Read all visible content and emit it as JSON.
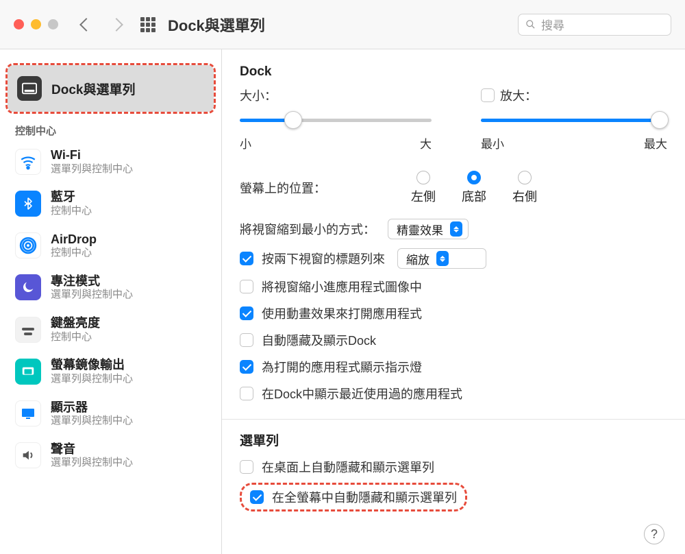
{
  "toolbar": {
    "title": "Dock與選單列",
    "search_placeholder": "搜尋"
  },
  "sidebar": {
    "selected": {
      "label": "Dock與選單列"
    },
    "section_label": "控制中心",
    "items": [
      {
        "title": "Wi-Fi",
        "sub": "選單列與控制中心"
      },
      {
        "title": "藍牙",
        "sub": "控制中心"
      },
      {
        "title": "AirDrop",
        "sub": "控制中心"
      },
      {
        "title": "專注模式",
        "sub": "選單列與控制中心"
      },
      {
        "title": "鍵盤亮度",
        "sub": "控制中心"
      },
      {
        "title": "螢幕鏡像輸出",
        "sub": "選單列與控制中心"
      },
      {
        "title": "顯示器",
        "sub": "選單列與控制中心"
      },
      {
        "title": "聲音",
        "sub": "選單列與控制中心"
      }
    ]
  },
  "main": {
    "dock_header": "Dock",
    "size_label": "大小：",
    "size_min": "小",
    "size_max": "大",
    "mag_label": "放大：",
    "mag_min": "最小",
    "mag_max": "最大",
    "position_label": "螢幕上的位置：",
    "pos_left": "左側",
    "pos_bottom": "底部",
    "pos_right": "右側",
    "minimize_label": "將視窗縮到最小的方式：",
    "minimize_value": "精靈效果",
    "dbl_label": "按兩下視窗的標題列來",
    "dbl_value": "縮放",
    "cb_minimize_into": "將視窗縮小進應用程式圖像中",
    "cb_animate": "使用動畫效果來打開應用程式",
    "cb_autohide": "自動隱藏及顯示Dock",
    "cb_indicator": "為打開的應用程式顯示指示燈",
    "cb_recents": "在Dock中顯示最近使用過的應用程式",
    "menu_header": "選單列",
    "cb_hide_desktop": "在桌面上自動隱藏和顯示選單列",
    "cb_hide_fullscreen": "在全螢幕中自動隱藏和顯示選單列",
    "help": "?"
  }
}
